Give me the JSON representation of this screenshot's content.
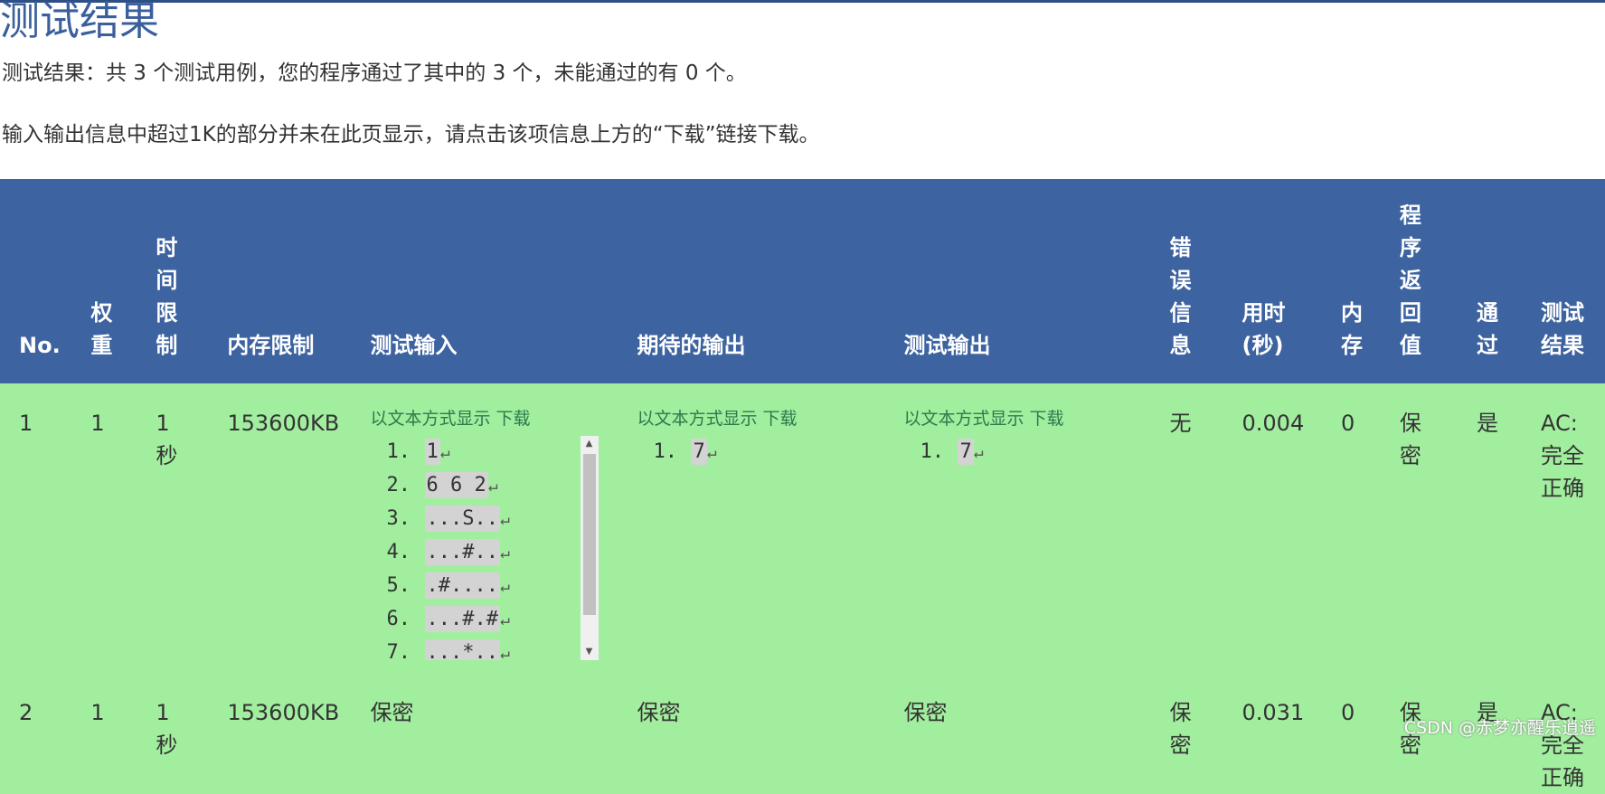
{
  "page": {
    "title": "测试结果",
    "summary": "测试结果：共 3 个测试用例，您的程序通过了其中的 3 个，未能通过的有 0 个。",
    "note": "输入输出信息中超过1K的部分并未在此页显示，请点击该项信息上方的“下载”链接下载。"
  },
  "table": {
    "headers": [
      "No.",
      "权重",
      "时间限制",
      "内存限制",
      "测试输入",
      "期待的输出",
      "测试输出",
      "错误信息",
      "用时(秒)",
      "内存",
      "程序返回值",
      "通过",
      "测试结果"
    ],
    "links": {
      "text_view": "以文本方式显示",
      "download": "下载"
    },
    "rows": [
      {
        "no": "1",
        "weight": "1",
        "time_limit": "1秒",
        "mem_limit": "153600KB",
        "input_lines": [
          "1",
          "6 6 2",
          "...S..",
          "...#..",
          ".#....",
          "...#.#",
          "...*.."
        ],
        "expected_lines": [
          "7"
        ],
        "output_lines": [
          "7"
        ],
        "error": "无",
        "time_used": "0.004",
        "memory": "0",
        "return_value": "保密",
        "passed": "是",
        "result": "AC:完全正确"
      },
      {
        "no": "2",
        "weight": "1",
        "time_limit": "1秒",
        "mem_limit": "153600KB",
        "input": "保密",
        "expected": "保密",
        "output": "保密",
        "error": "保密",
        "time_used": "0.031",
        "memory": "0",
        "return_value": "保密",
        "passed": "是",
        "result": "AC:完全正确"
      }
    ]
  },
  "watermark": "CSDN @赤梦亦醒乐逍遥",
  "colors": {
    "header_bg": "#3d63a0",
    "row_bg": "#a2ee9f",
    "title": "#3a5f9d",
    "link": "#2a7a4c"
  }
}
